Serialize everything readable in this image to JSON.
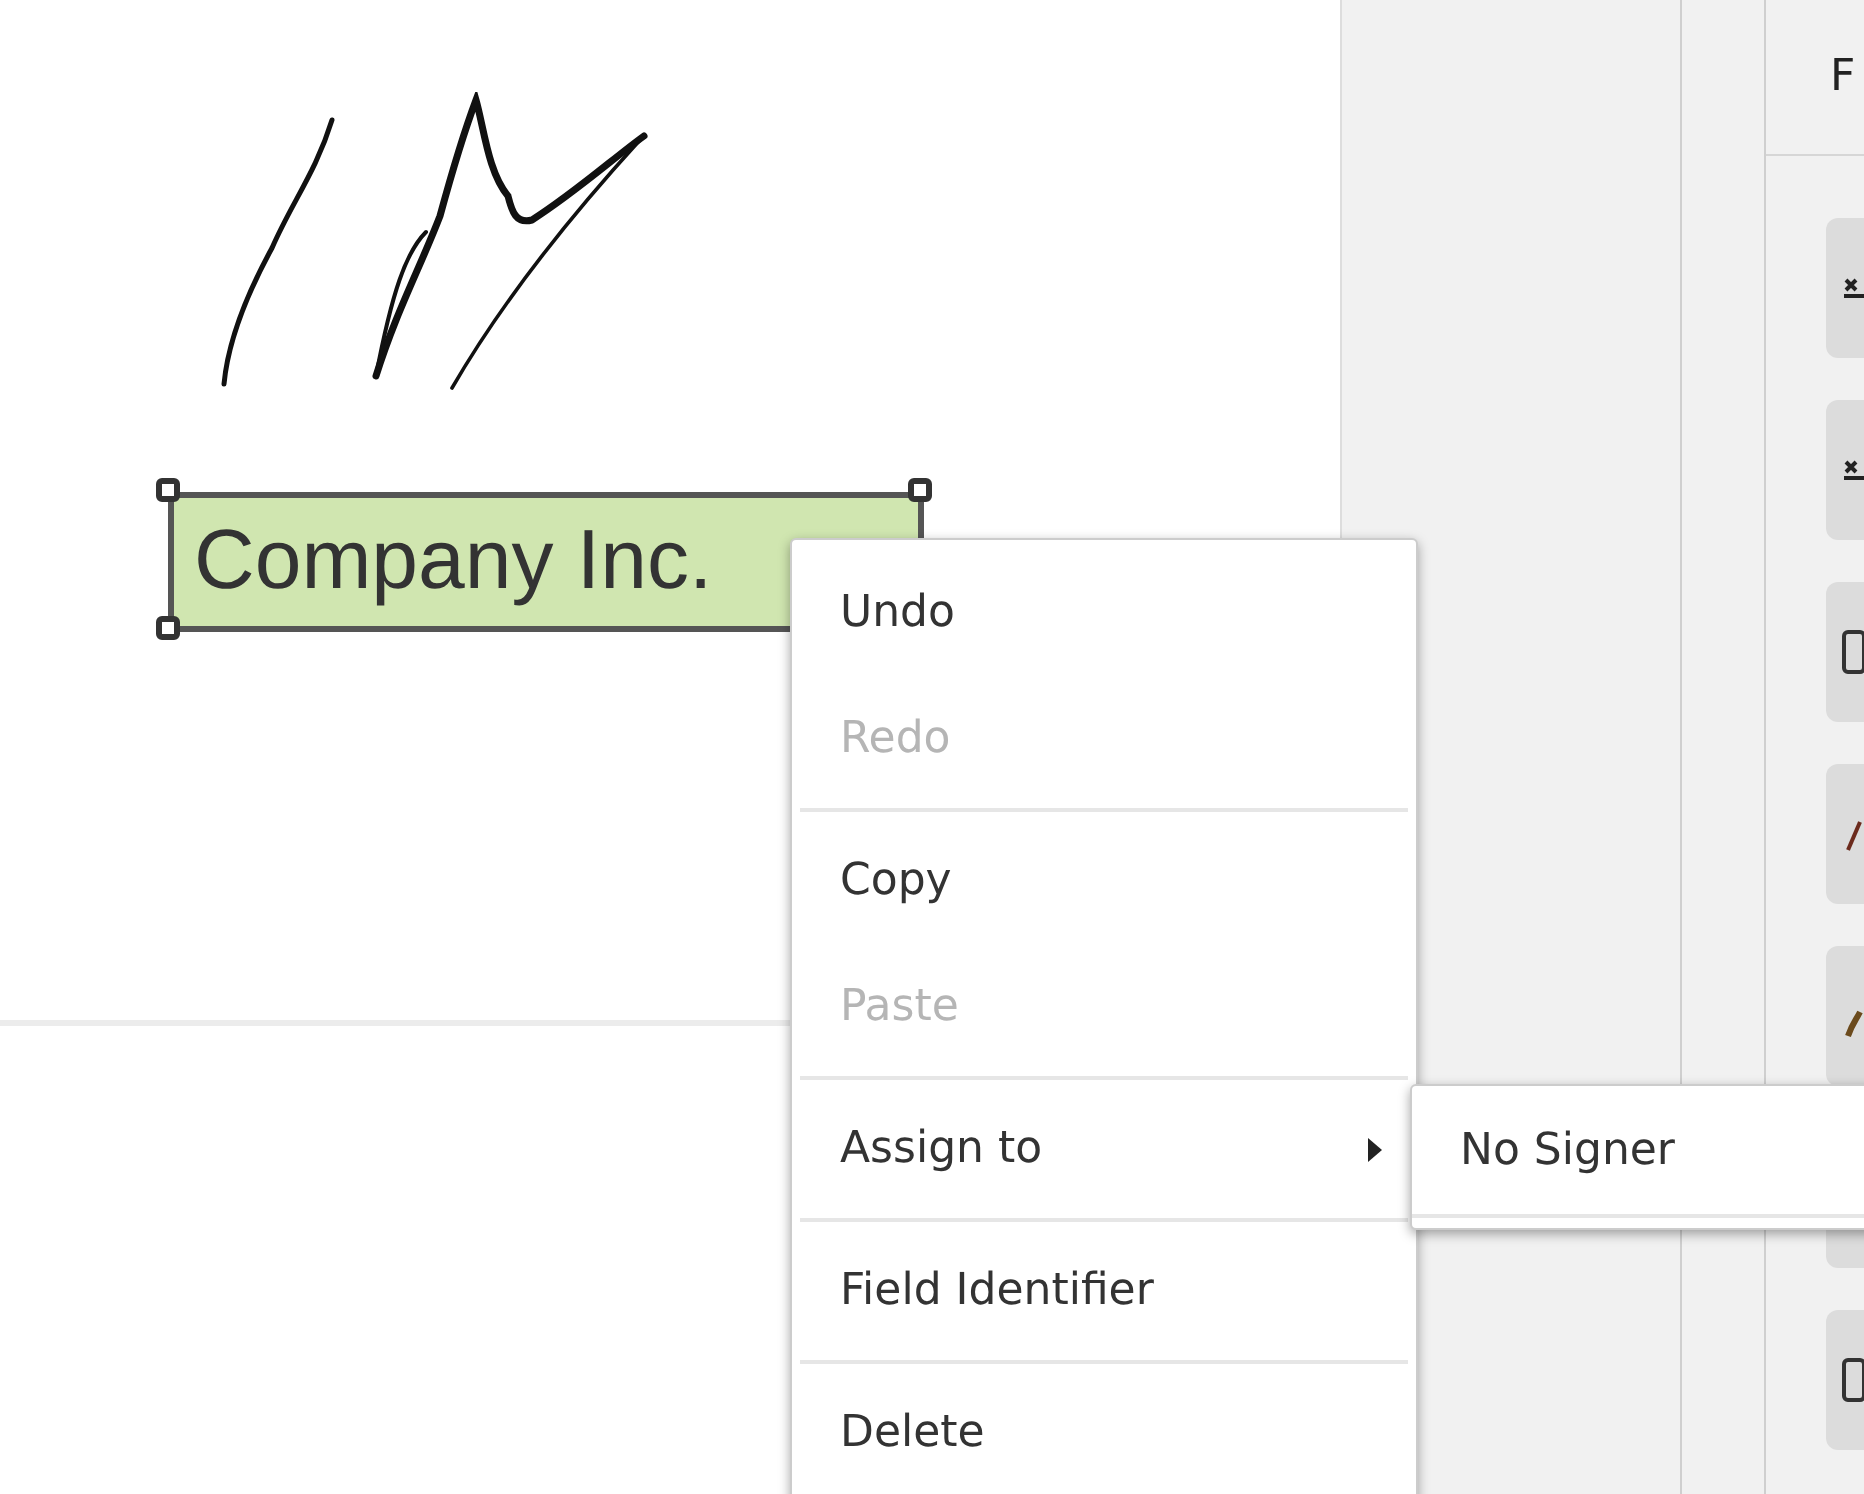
{
  "document": {
    "text_field": {
      "value": "Company Inc.",
      "selected": true
    }
  },
  "panel": {
    "title": "F"
  },
  "context_menu": {
    "items": [
      {
        "kind": "item",
        "label": "Undo",
        "disabled": false
      },
      {
        "kind": "item",
        "label": "Redo",
        "disabled": true
      },
      {
        "kind": "separator"
      },
      {
        "kind": "item",
        "label": "Copy",
        "disabled": false
      },
      {
        "kind": "item",
        "label": "Paste",
        "disabled": true
      },
      {
        "kind": "separator"
      },
      {
        "kind": "submenu",
        "label": "Assign to",
        "disabled": false,
        "expanded": true
      },
      {
        "kind": "separator"
      },
      {
        "kind": "item",
        "label": "Field Identifier",
        "disabled": false
      },
      {
        "kind": "separator"
      },
      {
        "kind": "item",
        "label": "Delete",
        "disabled": false
      }
    ]
  },
  "submenu": {
    "items": [
      {
        "label": "No Signer"
      }
    ]
  }
}
